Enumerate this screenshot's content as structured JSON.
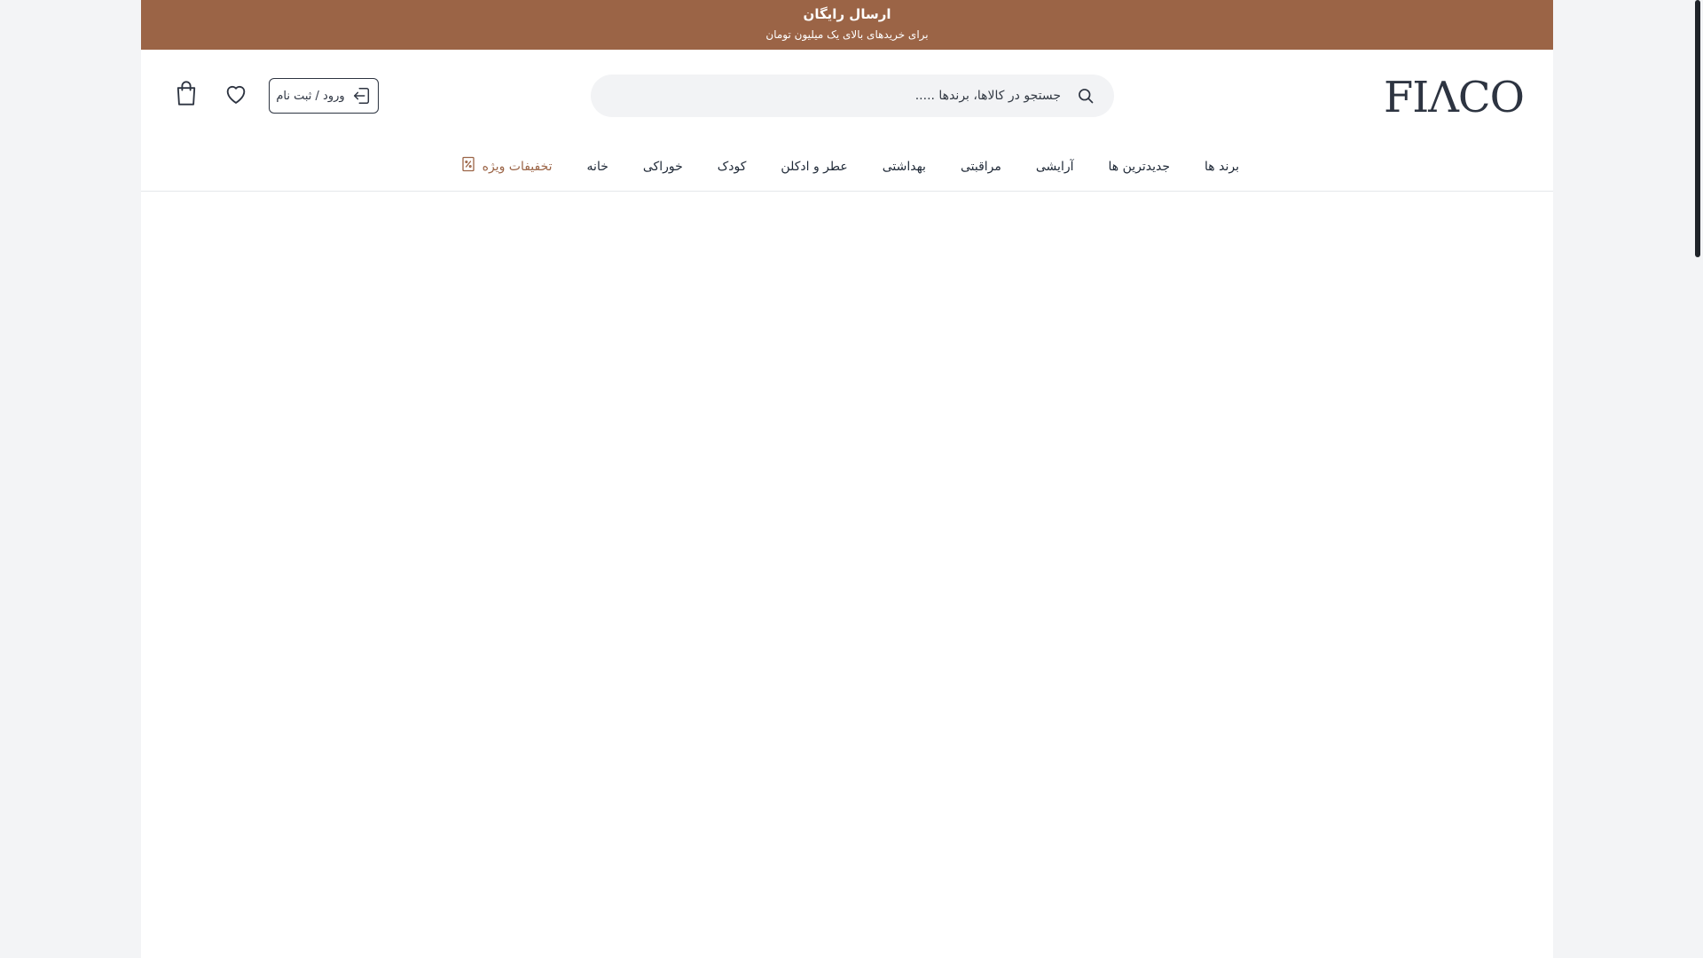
{
  "promo": {
    "title": "ارسال رایگان",
    "subtitle": "برای خریدهای بالای یک میلیون تومان",
    "background": "#9b6446"
  },
  "header": {
    "logo_text": "FIΛCO",
    "search": {
      "placeholder": "جستجو در کالاها، برندها .....",
      "icon": "search-icon"
    },
    "login_label": "ورود / ثبت نام",
    "login_icon": "login-icon",
    "wishlist_icon": "heart-icon",
    "cart_icon": "shopping-bag-icon"
  },
  "nav": {
    "items": [
      {
        "label": "برند ها"
      },
      {
        "label": "جدیدترین ها"
      },
      {
        "label": "آرایشی"
      },
      {
        "label": "مراقبتی"
      },
      {
        "label": "بهداشتی"
      },
      {
        "label": "عطر و ادکلن"
      },
      {
        "label": "کودک"
      },
      {
        "label": "خوراکی"
      },
      {
        "label": "خانه"
      }
    ],
    "special": {
      "label": "تخفیفات ویژه",
      "icon": "discount-tag-icon",
      "color": "#9b6446"
    }
  }
}
